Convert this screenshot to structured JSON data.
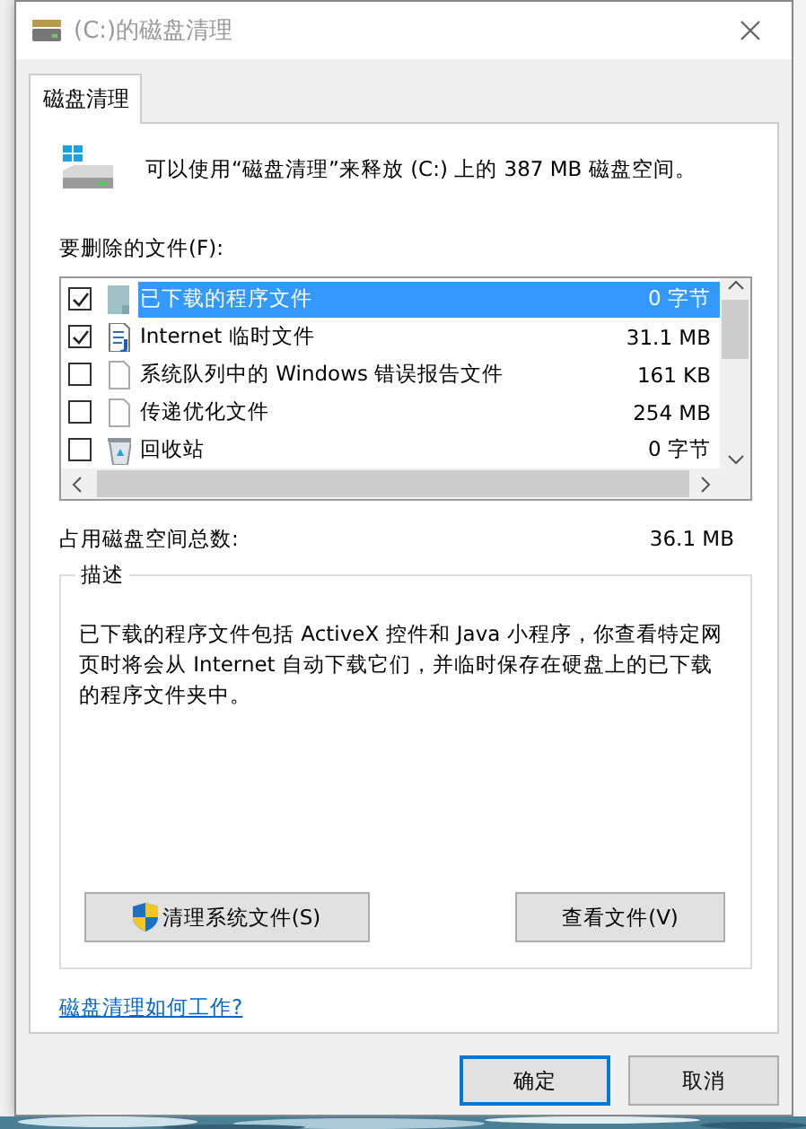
{
  "window": {
    "title": "(C:)的磁盘清理"
  },
  "tabs": [
    {
      "label": "磁盘清理",
      "selected": true
    }
  ],
  "intro": "可以使用“磁盘清理”来释放  (C:) 上的 387 MB 磁盘空间。",
  "files_label": "要删除的文件(F):",
  "files": [
    {
      "name": "已下载的程序文件",
      "size": "0 字节",
      "checked": true,
      "selected": true,
      "kind": "folder"
    },
    {
      "name": "Internet 临时文件",
      "size": "31.1 MB",
      "checked": true,
      "selected": false,
      "kind": "doc"
    },
    {
      "name": "系统队列中的 Windows 错误报告文件",
      "size": "161 KB",
      "checked": false,
      "selected": false,
      "kind": "page"
    },
    {
      "name": "传递优化文件",
      "size": "254 MB",
      "checked": false,
      "selected": false,
      "kind": "page"
    },
    {
      "name": "回收站",
      "size": "0 字节",
      "checked": false,
      "selected": false,
      "kind": "bin"
    }
  ],
  "total_label": "占用磁盘空间总数:",
  "total_value": "36.1 MB",
  "description": {
    "title": "描述",
    "text": "已下载的程序文件包括 ActiveX 控件和 Java 小程序，你查看特定网页时将会从 Internet 自动下载它们，并临时保存在硬盘上的已下载的程序文件夹中。"
  },
  "actions": [
    {
      "label": "清理系统文件(S)",
      "shield": true
    },
    {
      "label": "查看文件(V)",
      "shield": false
    }
  ],
  "help_link": "磁盘清理如何工作?",
  "buttons": [
    {
      "label": "确定",
      "default": true
    },
    {
      "label": "取消",
      "default": false
    }
  ]
}
